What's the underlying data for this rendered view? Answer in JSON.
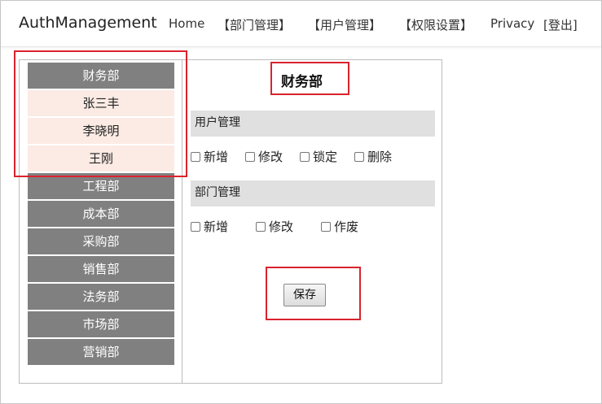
{
  "navbar": {
    "brand": "AuthManagement",
    "items": [
      "Home",
      "【部门管理】",
      "【用户管理】",
      "【权限设置】",
      "Privacy",
      "[登出]"
    ]
  },
  "departments": [
    "财务部",
    "工程部",
    "成本部",
    "采购部",
    "销售部",
    "法务部",
    "市场部",
    "营销部"
  ],
  "selected_department": {
    "name": "财务部",
    "users": [
      "张三丰",
      "李晓明",
      "王刚"
    ]
  },
  "panel": {
    "title": "财务部",
    "sections": [
      {
        "label": "用户管理",
        "permissions": [
          "新增",
          "修改",
          "锁定",
          "删除"
        ]
      },
      {
        "label": "部门管理",
        "permissions": [
          "新增",
          "修改",
          "作废"
        ]
      }
    ],
    "save_label": "保存"
  },
  "colors": {
    "dept_bg": "#808080",
    "user_bg": "#fbebe4",
    "section_bg": "#e0e0e0",
    "annotation_red": "#d9232d"
  }
}
